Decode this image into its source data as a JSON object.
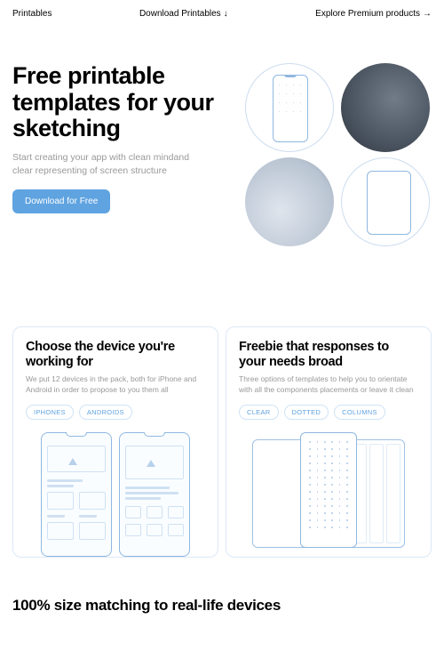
{
  "nav": {
    "brand": "Printables",
    "download": "Download Printables",
    "premium": "Explore Premium products"
  },
  "hero": {
    "title": "Free printable templates for your sketching",
    "subtitle": "Start creating your app with clean mindand clear representing of screen structure",
    "cta": "Download for Free"
  },
  "cards": [
    {
      "title": "Choose the device you're working for",
      "subtitle": "We put 12 devices in the pack, both for iPhone and Android in order to propose to you them all",
      "tags": [
        "IPHONES",
        "ANDROIDS"
      ]
    },
    {
      "title": "Freebie that responses to your needs broad",
      "subtitle": "Three options of templates to help you to orientate with all the components placements or leave it clean",
      "tags": [
        "CLEAR",
        "DOTTED",
        "COLUMNS"
      ]
    }
  ],
  "section3": {
    "title": "100% size matching to real-life devices"
  }
}
